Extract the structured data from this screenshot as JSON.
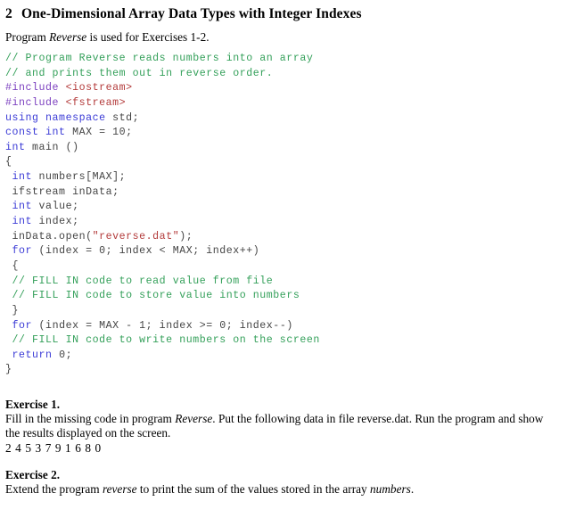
{
  "document": {
    "heading": {
      "number": "2",
      "title": "One-Dimensional Array Data Types with Integer Indexes"
    },
    "intro": {
      "before": "Program ",
      "program_name": "Reverse",
      "after": " is used for Exercises 1-2."
    },
    "code": {
      "language": "cpp",
      "colors": {
        "comment": "#34a05a",
        "preprocessor": "#7b3fbf",
        "header": "#b33a3a",
        "keyword": "#3b3bd6",
        "string": "#b33a3a",
        "plain": "#444444"
      },
      "lines": [
        [
          {
            "t": "comment",
            "s": "// Program Reverse reads numbers into an array"
          }
        ],
        [
          {
            "t": "comment",
            "s": "// and prints them out in reverse order."
          }
        ],
        [
          {
            "t": "pre",
            "s": "#include"
          },
          {
            "t": "plain",
            "s": " "
          },
          {
            "t": "header",
            "s": "<iostream>"
          }
        ],
        [
          {
            "t": "pre",
            "s": "#include"
          },
          {
            "t": "plain",
            "s": " "
          },
          {
            "t": "header",
            "s": "<fstream>"
          }
        ],
        [
          {
            "t": "kw",
            "s": "using namespace"
          },
          {
            "t": "plain",
            "s": " std;"
          }
        ],
        [
          {
            "t": "kw",
            "s": "const int"
          },
          {
            "t": "plain",
            "s": " MAX = 10;"
          }
        ],
        [
          {
            "t": "kw",
            "s": "int"
          },
          {
            "t": "plain",
            "s": " main ()"
          }
        ],
        [
          {
            "t": "plain",
            "s": "{"
          }
        ],
        [
          {
            "t": "plain",
            "s": " "
          },
          {
            "t": "kw",
            "s": "int"
          },
          {
            "t": "plain",
            "s": " numbers[MAX];"
          }
        ],
        [
          {
            "t": "plain",
            "s": " ifstream inData;"
          }
        ],
        [
          {
            "t": "plain",
            "s": " "
          },
          {
            "t": "kw",
            "s": "int"
          },
          {
            "t": "plain",
            "s": " value;"
          }
        ],
        [
          {
            "t": "plain",
            "s": " "
          },
          {
            "t": "kw",
            "s": "int"
          },
          {
            "t": "plain",
            "s": " index;"
          }
        ],
        [
          {
            "t": "plain",
            "s": " inData.open("
          },
          {
            "t": "str",
            "s": "\"reverse.dat\""
          },
          {
            "t": "plain",
            "s": ");"
          }
        ],
        [
          {
            "t": "plain",
            "s": " "
          },
          {
            "t": "kw",
            "s": "for"
          },
          {
            "t": "plain",
            "s": " (index = 0; index < MAX; index++)"
          }
        ],
        [
          {
            "t": "plain",
            "s": " {"
          }
        ],
        [
          {
            "t": "plain",
            "s": " "
          },
          {
            "t": "comment",
            "s": "// FILL IN code to read value from file"
          }
        ],
        [
          {
            "t": "plain",
            "s": " "
          },
          {
            "t": "comment",
            "s": "// FILL IN code to store value into numbers"
          }
        ],
        [
          {
            "t": "plain",
            "s": " }"
          }
        ],
        [
          {
            "t": "plain",
            "s": " "
          },
          {
            "t": "kw",
            "s": "for"
          },
          {
            "t": "plain",
            "s": " (index = MAX - 1; index >= 0; index--)"
          }
        ],
        [
          {
            "t": "plain",
            "s": " "
          },
          {
            "t": "comment",
            "s": "// FILL IN code to write numbers on the screen"
          }
        ],
        [
          {
            "t": "plain",
            "s": " "
          },
          {
            "t": "kw",
            "s": "return"
          },
          {
            "t": "plain",
            "s": " 0;"
          }
        ],
        [
          {
            "t": "plain",
            "s": "}"
          }
        ]
      ]
    },
    "exercises": [
      {
        "title": "Exercise 1.",
        "body_parts": [
          {
            "style": "normal",
            "s": "Fill in the missing code in program "
          },
          {
            "style": "italic",
            "s": "Reverse"
          },
          {
            "style": "normal",
            "s": ". Put the following data in file reverse.dat. Run the program and show the results displayed on the screen."
          }
        ],
        "data_line": "2 4 5 3 7 9 1 6 8 0"
      },
      {
        "title": "Exercise 2.",
        "body_parts": [
          {
            "style": "normal",
            "s": "Extend the program "
          },
          {
            "style": "italic",
            "s": "reverse"
          },
          {
            "style": "normal",
            "s": " to print the sum of the values stored in the array "
          },
          {
            "style": "italic",
            "s": "numbers"
          },
          {
            "style": "normal",
            "s": "."
          }
        ],
        "data_line": ""
      }
    ]
  }
}
